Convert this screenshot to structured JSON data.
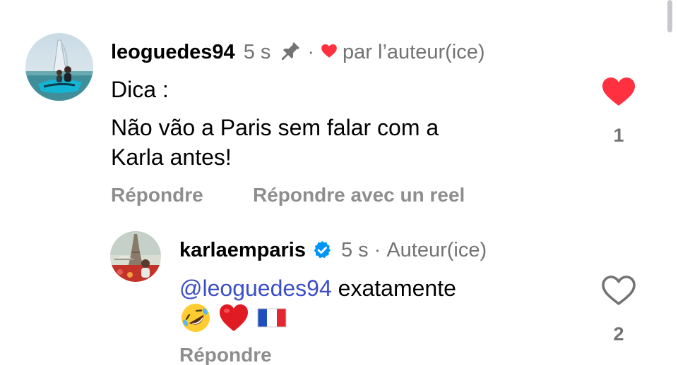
{
  "comment1": {
    "username": "leoguedes94",
    "time": "5 s",
    "separator": "·",
    "liked_by": "par l’auteur(ice)",
    "lines": [
      "Dica :",
      "Não vão a Paris sem falar com a",
      "Karla antes!"
    ],
    "reply_label": "Répondre",
    "reply_reel_label": "Répondre avec un reel",
    "like_count": "1",
    "liked": true
  },
  "comment2": {
    "username": "karlaemparis",
    "time": "5 s",
    "separator": "·",
    "author_label": "Auteur(ice)",
    "mention": "@leoguedes94",
    "text": " exatamente",
    "emojis": [
      "rolling-on-floor-laughing",
      "red-heart",
      "france-flag"
    ],
    "reply_label": "Répondre",
    "like_count": "2",
    "liked": false
  },
  "colors": {
    "like_red": "#ff3040",
    "mention_blue": "#3b4ec9",
    "verified_blue": "#0095f6",
    "muted_gray": "#737373"
  },
  "icons": [
    "pin-icon",
    "heart-icon",
    "verified-badge-icon",
    "heart-outline-icon"
  ]
}
